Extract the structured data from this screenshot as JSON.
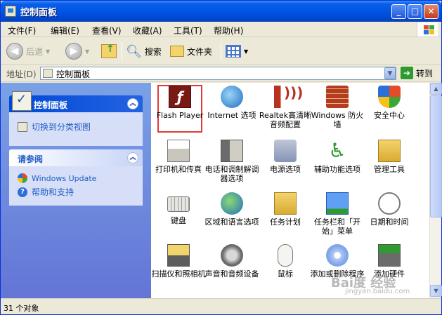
{
  "window": {
    "title": "控制面板"
  },
  "menu": [
    "文件(F)",
    "编辑(E)",
    "查看(V)",
    "收藏(A)",
    "工具(T)",
    "帮助(H)"
  ],
  "toolbar": {
    "back": "后退",
    "search": "搜索",
    "folders": "文件夹"
  },
  "address": {
    "label": "地址(D)",
    "value": "控制面板",
    "go": "转到"
  },
  "left": {
    "panel1_title": "控制面板",
    "switch_view": "切换到分类视图",
    "panel2_title": "请参阅",
    "windows_update": "Windows Update",
    "help": "帮助和支持"
  },
  "items": [
    {
      "label": "Flash Player",
      "icon": "flash-icon"
    },
    {
      "label": "Internet 选项",
      "icon": "internet-options-icon"
    },
    {
      "label": "Realtek高清晰音频配置",
      "icon": "realtek-audio-icon"
    },
    {
      "label": "Windows 防火墙",
      "icon": "firewall-icon"
    },
    {
      "label": "安全中心",
      "icon": "security-center-icon"
    },
    {
      "label": "打印机和传真",
      "icon": "printer-icon"
    },
    {
      "label": "电话和调制解调器选项",
      "icon": "phone-modem-icon"
    },
    {
      "label": "电源选项",
      "icon": "power-options-icon"
    },
    {
      "label": "辅助功能选项",
      "icon": "accessibility-icon"
    },
    {
      "label": "管理工具",
      "icon": "admin-tools-icon"
    },
    {
      "label": "键盘",
      "icon": "keyboard-icon"
    },
    {
      "label": "区域和语言选项",
      "icon": "globe-icon"
    },
    {
      "label": "任务计划",
      "icon": "scheduled-tasks-icon"
    },
    {
      "label": "任务栏和「开始」菜单",
      "icon": "taskbar-icon"
    },
    {
      "label": "日期和时间",
      "icon": "clock-icon"
    },
    {
      "label": "扫描仪和照相机",
      "icon": "scanner-camera-icon"
    },
    {
      "label": "声音和音频设备",
      "icon": "speaker-icon"
    },
    {
      "label": "鼠标",
      "icon": "mouse-icon"
    },
    {
      "label": "添加或删除程序",
      "icon": "add-remove-programs-icon"
    },
    {
      "label": "添加硬件",
      "icon": "add-hardware-icon"
    }
  ],
  "status": "31 个对象",
  "watermark": {
    "main": "Bai度 经验",
    "sub": "jingyan.baidu.com"
  }
}
